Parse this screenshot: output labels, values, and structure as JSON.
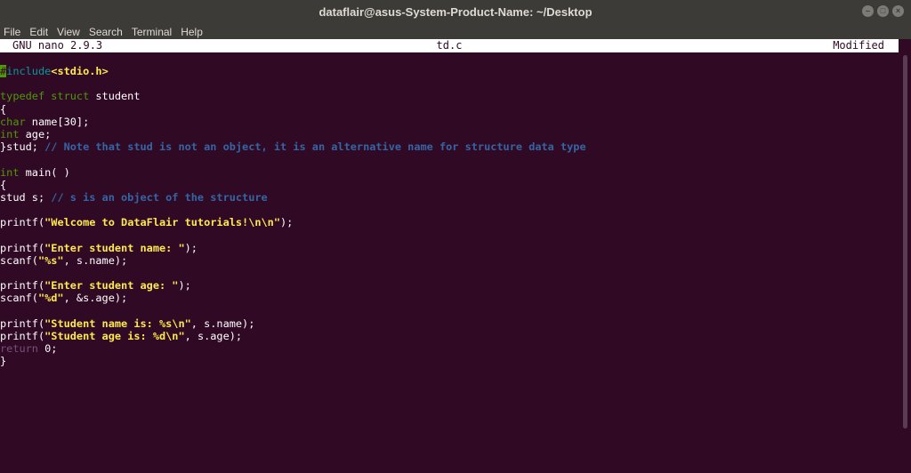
{
  "window": {
    "title": "dataflair@asus-System-Product-Name: ~/Desktop",
    "minimize": "–",
    "maximize": "□",
    "close": "×"
  },
  "menu": [
    "File",
    "Edit",
    "View",
    "Search",
    "Terminal",
    "Help"
  ],
  "nano": {
    "version": "GNU nano 2.9.3",
    "filename": "td.c",
    "status": "Modified"
  },
  "code": [
    [
      {
        "t": "#",
        "c": "cursor"
      },
      {
        "t": "include",
        "c": "pp"
      },
      {
        "t": "<stdio.h>",
        "c": "st"
      }
    ],
    [],
    [
      {
        "t": "typedef struct",
        "c": "kw"
      },
      {
        "t": " student"
      }
    ],
    [
      {
        "t": "{"
      }
    ],
    [
      {
        "t": "char",
        "c": "kw"
      },
      {
        "t": " name[30];"
      }
    ],
    [
      {
        "t": "int",
        "c": "kw"
      },
      {
        "t": " age;"
      }
    ],
    [
      {
        "t": "}stud; "
      },
      {
        "t": "// Note that stud is not an object, it is an alternative name for structure data type",
        "c": "cm"
      }
    ],
    [],
    [
      {
        "t": "int",
        "c": "kw"
      },
      {
        "t": " main( )"
      }
    ],
    [
      {
        "t": "{"
      }
    ],
    [
      {
        "t": "stud s; "
      },
      {
        "t": "// s is an object of the structure",
        "c": "cm"
      }
    ],
    [],
    [
      {
        "t": "printf("
      },
      {
        "t": "\"Welcome to DataFlair tutorials!\\n\\n\"",
        "c": "st"
      },
      {
        "t": ");"
      }
    ],
    [],
    [
      {
        "t": "printf("
      },
      {
        "t": "\"Enter student name: \"",
        "c": "st"
      },
      {
        "t": ");"
      }
    ],
    [
      {
        "t": "scanf("
      },
      {
        "t": "\"%s\"",
        "c": "st"
      },
      {
        "t": ", s.name);"
      }
    ],
    [],
    [
      {
        "t": "printf("
      },
      {
        "t": "\"Enter student age: \"",
        "c": "st"
      },
      {
        "t": ");"
      }
    ],
    [
      {
        "t": "scanf("
      },
      {
        "t": "\"%d\"",
        "c": "st"
      },
      {
        "t": ", &s.age);"
      }
    ],
    [],
    [
      {
        "t": "printf("
      },
      {
        "t": "\"Student name is: %s\\n\"",
        "c": "st"
      },
      {
        "t": ", s.name);"
      }
    ],
    [
      {
        "t": "printf("
      },
      {
        "t": "\"Student age is: %d\\n\"",
        "c": "st"
      },
      {
        "t": ", s.age);"
      }
    ],
    [
      {
        "t": "return",
        "c": "ret"
      },
      {
        "t": " 0;"
      }
    ],
    [
      {
        "t": "}"
      }
    ]
  ]
}
